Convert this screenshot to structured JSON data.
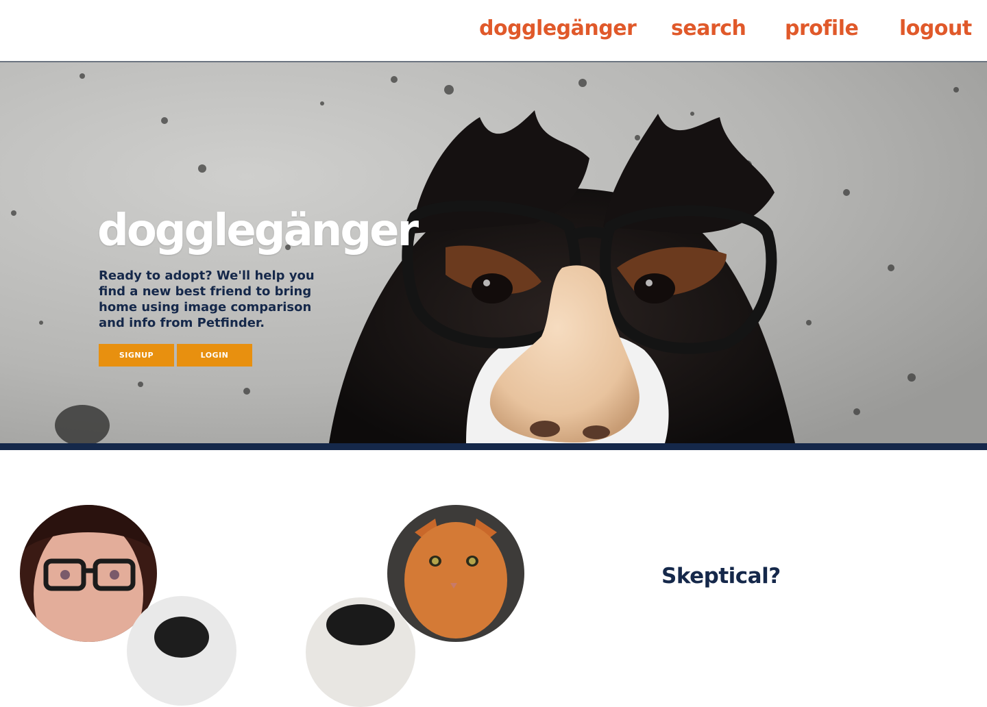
{
  "nav": {
    "brand": "dogglegänger",
    "search": "search",
    "profile": "profile",
    "logout": "logout",
    "link_color": "#e0592a"
  },
  "hero": {
    "title": "dogglegänger",
    "tagline": "Ready to adopt? We'll help you find a new best friend to bring home using image comparison and info from Petfinder.",
    "signup_label": "SIGNUP",
    "login_label": "LOGIN",
    "button_color": "#e8900f",
    "band_color": "#15284a",
    "image": "dog-wearing-groucho-glasses-photo"
  },
  "comparison": {
    "heading": "Skeptical?",
    "left_photos": [
      "person-with-glasses-photo",
      "dog-photo"
    ],
    "right_photos": [
      "orange-cat-photo",
      "black-and-white-animal-photo"
    ]
  }
}
